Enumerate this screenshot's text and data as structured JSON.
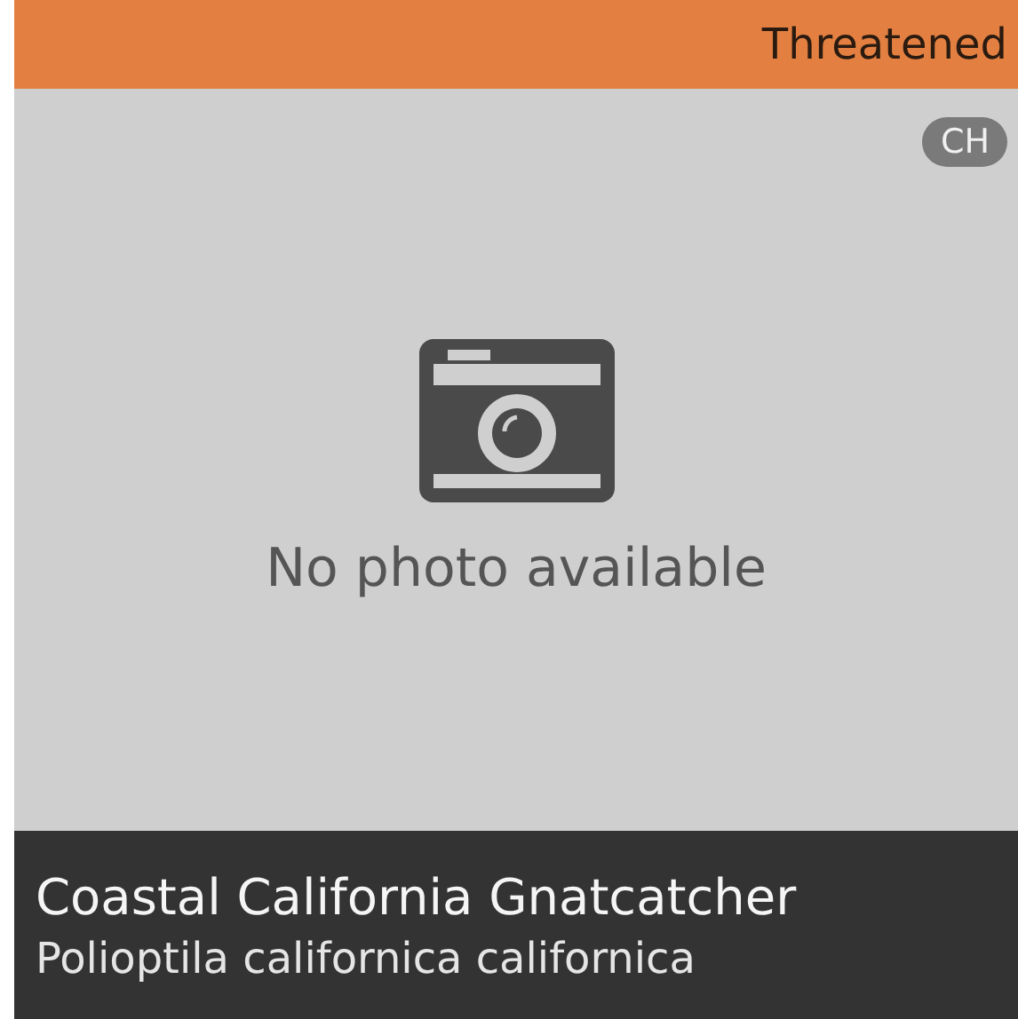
{
  "status": "Threatened",
  "region_badge": "CH",
  "photo": {
    "placeholder": "No photo available"
  },
  "common_name": "Coastal California Gnatcatcher",
  "scientific_name": "Polioptila californica californica"
}
